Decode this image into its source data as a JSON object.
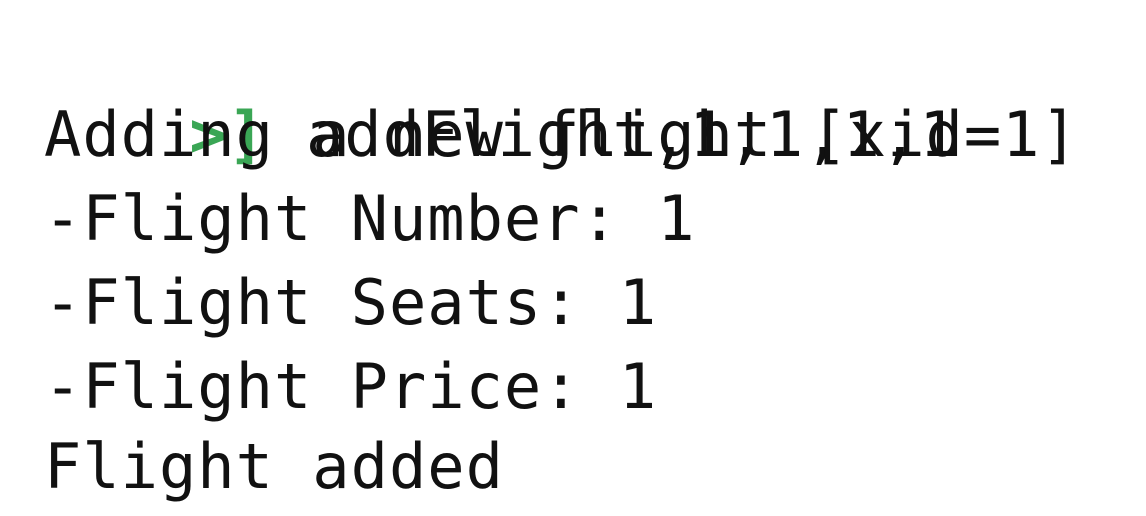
{
  "terminal": {
    "prompt": ">]",
    "command": "addFlight,1,1,1,1",
    "output": [
      "Adding a new flight [xid=1]",
      "-Flight Number: 1",
      "-Flight Seats: 1",
      "-Flight Price: 1",
      "Flight added"
    ],
    "colors": {
      "prompt": "#3aa655",
      "text": "#111111",
      "background": "#ffffff"
    }
  }
}
